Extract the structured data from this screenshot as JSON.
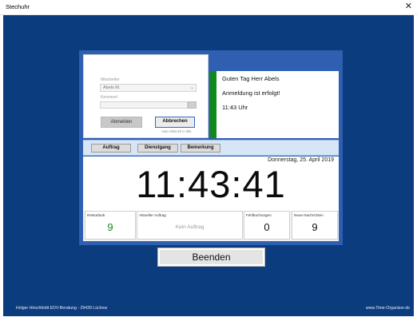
{
  "window": {
    "title": "Stechuhr",
    "close_icon": "close-icon"
  },
  "login": {
    "mitarbeiter_label": "Mitarbeiter",
    "mitarbeiter_value": "Abels M.",
    "kennwort_label": "Kennwort",
    "kennwort_value": "",
    "abmelden_label": "Abmelden",
    "abbrechen_label": "Abbrechen",
    "auto_abbruch_text": "Auto Abbruch in 29s"
  },
  "messages": {
    "greeting": "Guten Tag Herr Abels",
    "status": "Anmeldung ist erfolgt!",
    "time": "11:43 Uhr"
  },
  "status_color": "#108a1c",
  "toolbar": {
    "auftrag": "Auftrag",
    "dienstgang": "Dienstgang",
    "bemerkung": "Bemerkung"
  },
  "clock": {
    "date": "Donnerstag, 25. April 2019",
    "time": "11:43:41"
  },
  "info": {
    "resturlaub_label": "Resturlaub",
    "resturlaub_value": "9",
    "auftrag_label": "Aktueller Auftrag",
    "auftrag_value": "Kein Auftrag",
    "fehlbuchungen_label": "Fehlbuchungen",
    "fehlbuchungen_value": "0",
    "nachrichten_label": "Neue Nachrichten",
    "nachrichten_value": "9"
  },
  "beenden_label": "Beenden",
  "footer": {
    "left": "Holger Hirschfeldt EDV-Beratung - 29439 Lüchow",
    "right": "www.Time-Organizer.de"
  },
  "colors": {
    "background": "#0b3c7d",
    "panel": "#2e5fb1",
    "toolbar": "#d7e6f7",
    "resturlaub_value": "#108a1c"
  }
}
